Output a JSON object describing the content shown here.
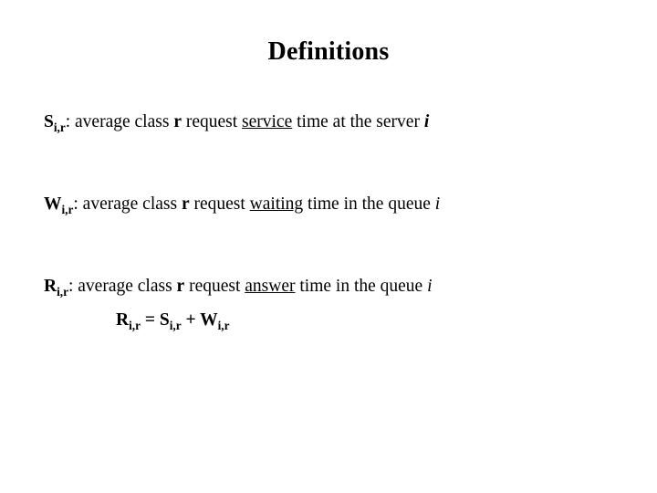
{
  "slide": {
    "title": "Definitions",
    "background_color": "#ffffff",
    "text_color": "#000000",
    "definitions": [
      {
        "symbol": "S",
        "subscript": "i,r",
        "colon": ":",
        "lead_text": " average class ",
        "class_var": "r",
        "mid_text": " request ",
        "keyword": "service",
        "tail_text": " time at the server ",
        "index_var": "i"
      },
      {
        "symbol": "W",
        "subscript": "i,r",
        "colon": ":",
        "lead_text": " average class ",
        "class_var": "r",
        "mid_text": " request ",
        "keyword": "waiting",
        "tail_text": " time in the queue ",
        "index_var": "i"
      },
      {
        "symbol": "R",
        "subscript": "i,r",
        "colon": ":",
        "lead_text": " average class ",
        "class_var": "r",
        "mid_text": " request ",
        "keyword": "answer",
        "tail_text": " time in the queue ",
        "index_var": "i"
      }
    ],
    "equation": {
      "lhs_symbol": "R",
      "lhs_subscript": "i,r",
      "equals": " = ",
      "term1_symbol": "S",
      "term1_subscript": "i,r",
      "plus": " + ",
      "term2_symbol": "W",
      "term2_subscript": "i,r"
    }
  }
}
